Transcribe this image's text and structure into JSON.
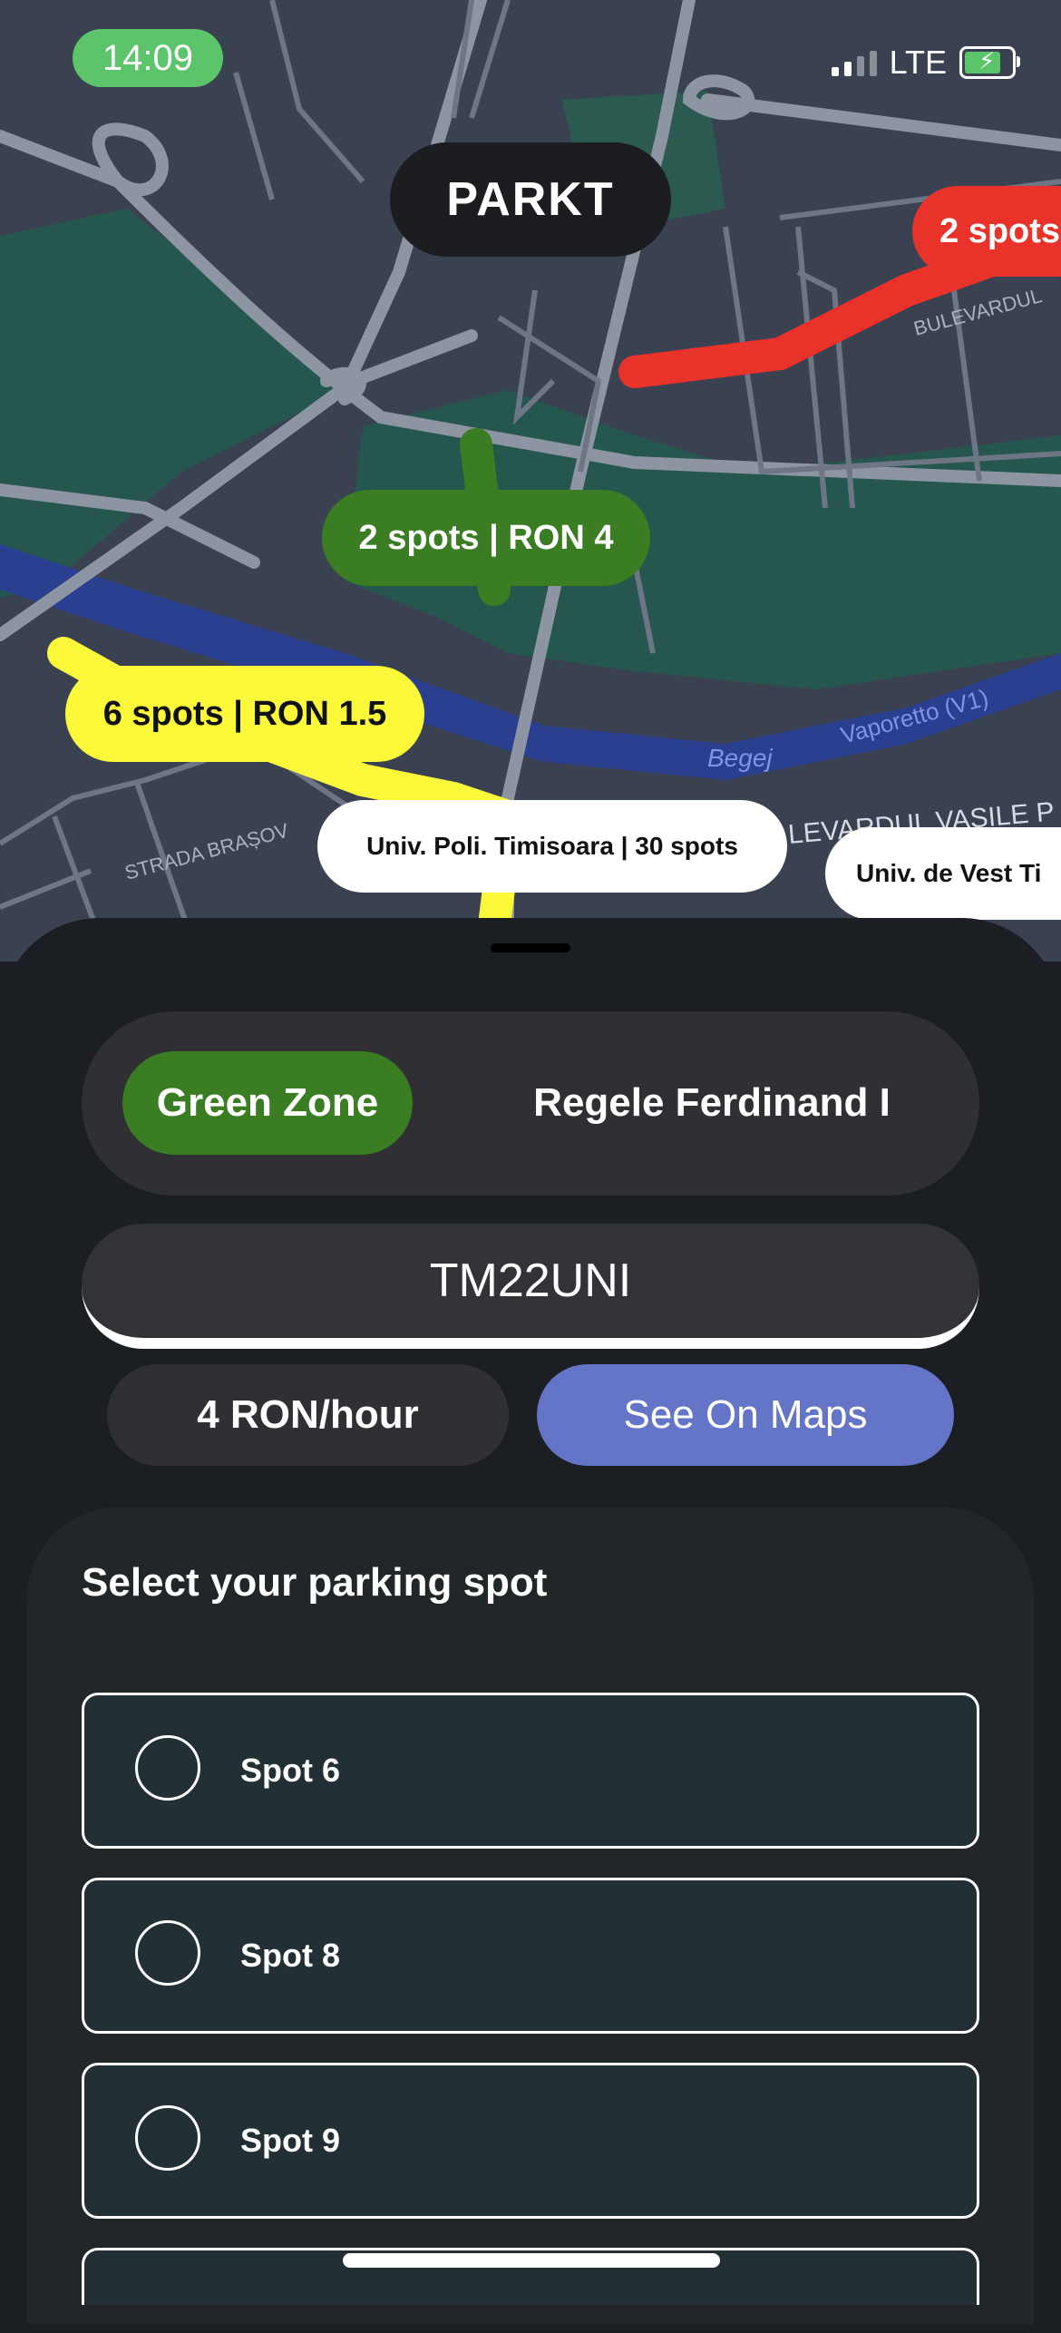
{
  "status_bar": {
    "time": "14:09",
    "network": "LTE"
  },
  "app": {
    "brand": "PARKT"
  },
  "map": {
    "street_labels": [
      "BULEVARDUL",
      "Vaporetto (V1)",
      "Begej",
      "STRADA BRAȘOV",
      "LEVARDUL VASILE P"
    ],
    "markers": {
      "red": "2 spots",
      "green": "2 spots | RON 4",
      "yellow": "6 spots | RON 1.5",
      "white_1": "Univ. Poli. Timisoara | 30 spots",
      "white_2": "Univ. de Vest Ti"
    }
  },
  "zones": {
    "active": "Green Zone",
    "other": "Regele Ferdinand I"
  },
  "plate": "TM22UNI",
  "rate": "4 RON/hour",
  "see_on_maps": "See On Maps",
  "parking": {
    "title": "Select your parking spot",
    "spots": [
      "Spot 6",
      "Spot 8",
      "Spot 9"
    ]
  },
  "colors": {
    "green_zone": "#3a7d22",
    "red_route": "#e8322a",
    "yellow_route": "#fbf83a",
    "maps_button": "#6475c8"
  }
}
